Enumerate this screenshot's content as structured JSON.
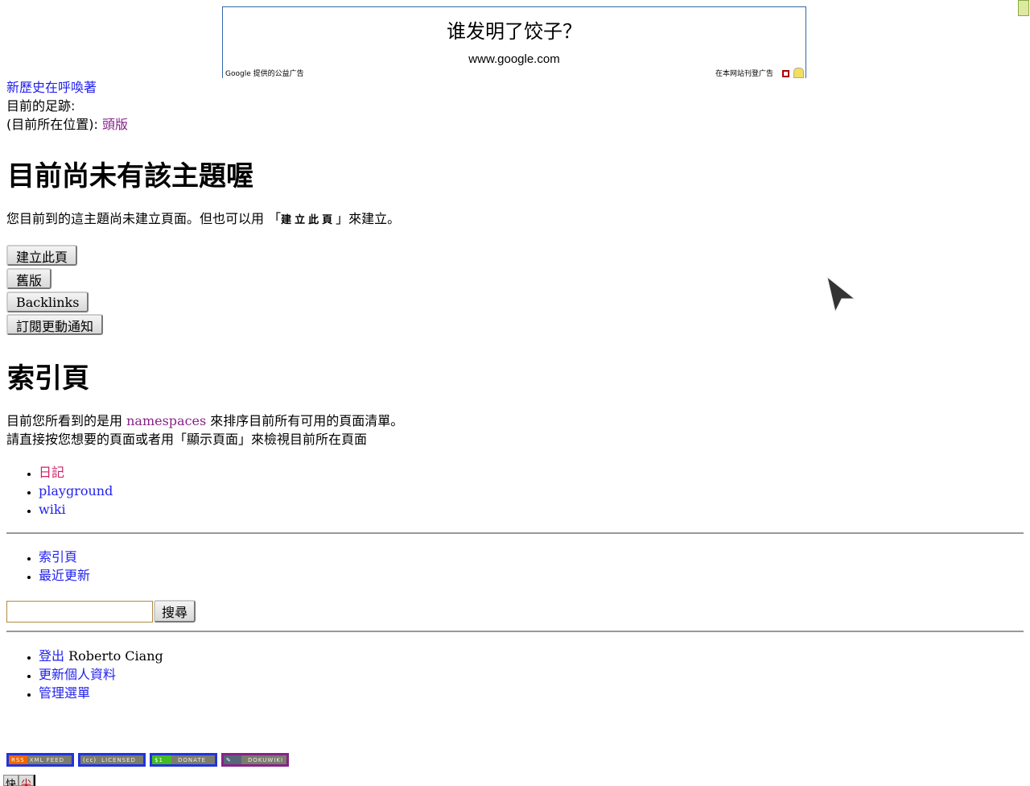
{
  "ad": {
    "question": "谁发明了饺子？",
    "url": "www.google.com",
    "left_label": "Google 提供的公益广告",
    "right_label": "在本网站刊登广告"
  },
  "site_title": "新歷史在呼喚著",
  "trace_label": "目前的足跡:",
  "location_label": "(目前所在位置):",
  "location_link": "頭版",
  "heading": "目前尚未有該主題喔",
  "notice": {
    "before": "您目前到的這主題尚未建立頁面。但也可以用 「",
    "button_ref": "建立此頁",
    "after": "」來建立。"
  },
  "buttons": [
    "建立此頁",
    "舊版",
    "Backlinks",
    "訂閱更動通知"
  ],
  "index_heading": "索引頁",
  "index_text": {
    "line1_before": "目前您所看到的是用 ",
    "line1_link": "namespaces",
    "line1_after": " 來排序目前所有可用的頁面清單。",
    "line2": "請直接按您想要的頁面或者用「顯示頁面」來檢視目前所在頁面"
  },
  "namespaces": [
    "日記",
    "playground",
    "wiki"
  ],
  "footer_links": [
    "索引頁",
    "最近更新"
  ],
  "search": {
    "value": "",
    "button": "搜尋"
  },
  "user_links": {
    "logout": "登出",
    "user": "Roberto Ciang",
    "profile": "更新個人資料",
    "admin": "管理選單"
  },
  "badges": [
    {
      "left": "RSS",
      "right": "XML FEED",
      "left_color": "#ee6600"
    },
    {
      "left": "(cc)",
      "right": "LICENSED",
      "left_color": "#7b7b6e"
    },
    {
      "left": "$1",
      "right": "DONATE",
      "left_color": "#44bb22"
    },
    {
      "left": "✎",
      "right": "DOKUWIKI",
      "left_color": "#556677"
    }
  ],
  "bottom_chars": [
    "快",
    "尖"
  ]
}
